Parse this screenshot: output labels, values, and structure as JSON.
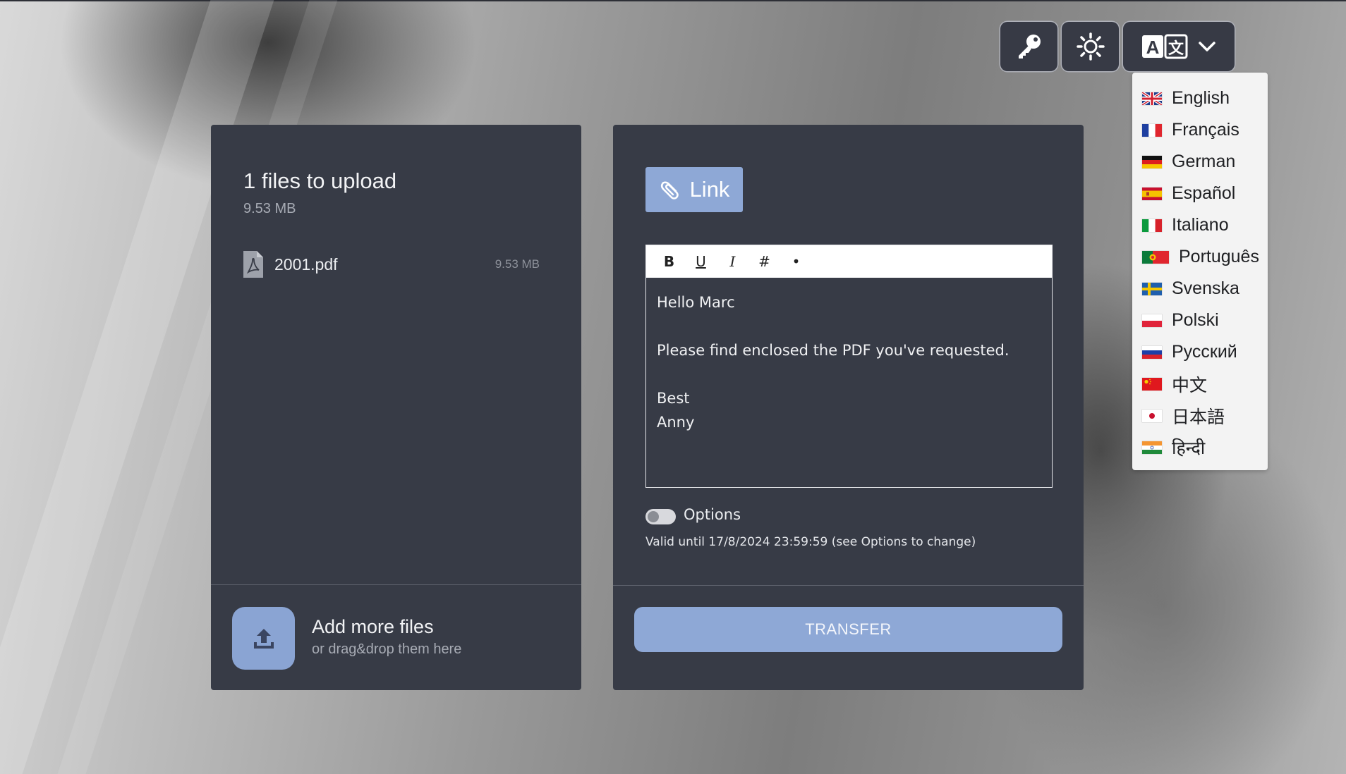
{
  "header": {
    "key_icon": "key-icon",
    "theme_icon": "sun-icon",
    "language_icon": "translate-icon",
    "language_chevron_icon": "chevron-down-icon"
  },
  "language_menu": {
    "items": [
      {
        "label": "English",
        "flag": "flag-uk-icon"
      },
      {
        "label": "Français",
        "flag": "flag-fr-icon"
      },
      {
        "label": "German",
        "flag": "flag-de-icon"
      },
      {
        "label": "Español",
        "flag": "flag-es-icon"
      },
      {
        "label": "Italiano",
        "flag": "flag-it-icon"
      },
      {
        "label": "Português",
        "flag": "flag-pt-icon"
      },
      {
        "label": "Svenska",
        "flag": "flag-se-icon"
      },
      {
        "label": "Polski",
        "flag": "flag-pl-icon"
      },
      {
        "label": "Русский",
        "flag": "flag-ru-icon"
      },
      {
        "label": "中文",
        "flag": "flag-cn-icon"
      },
      {
        "label": "日本語",
        "flag": "flag-jp-icon"
      },
      {
        "label": "हिन्दी",
        "flag": "flag-in-icon"
      }
    ]
  },
  "upload": {
    "title": "1 files to upload",
    "total_size": "9.53 MB",
    "files": [
      {
        "name": "2001.pdf",
        "size": "9.53 MB",
        "icon": "pdf-file-icon"
      }
    ],
    "add_more_title": "Add more files",
    "add_more_subtitle": "or drag&drop them here",
    "add_icon": "upload-icon"
  },
  "transfer": {
    "mode_label": "Link",
    "mode_icon": "paperclip-icon",
    "toolbar": {
      "bold": "B",
      "underline": "U",
      "italic": "I",
      "heading": "#",
      "bullet": "•"
    },
    "message_lines": [
      "Hello Marc",
      "",
      "Please find enclosed the PDF you've requested.",
      "",
      "Best",
      "Anny"
    ],
    "options_label": "Options",
    "options_enabled": false,
    "valid_until": "Valid until 17/8/2024 23:59:59 (see Options to change)",
    "transfer_label": "TRANSFER"
  },
  "colors": {
    "panel": "#373b46",
    "accent": "#8ea8d6",
    "menu_bg": "#f3f3f3"
  }
}
